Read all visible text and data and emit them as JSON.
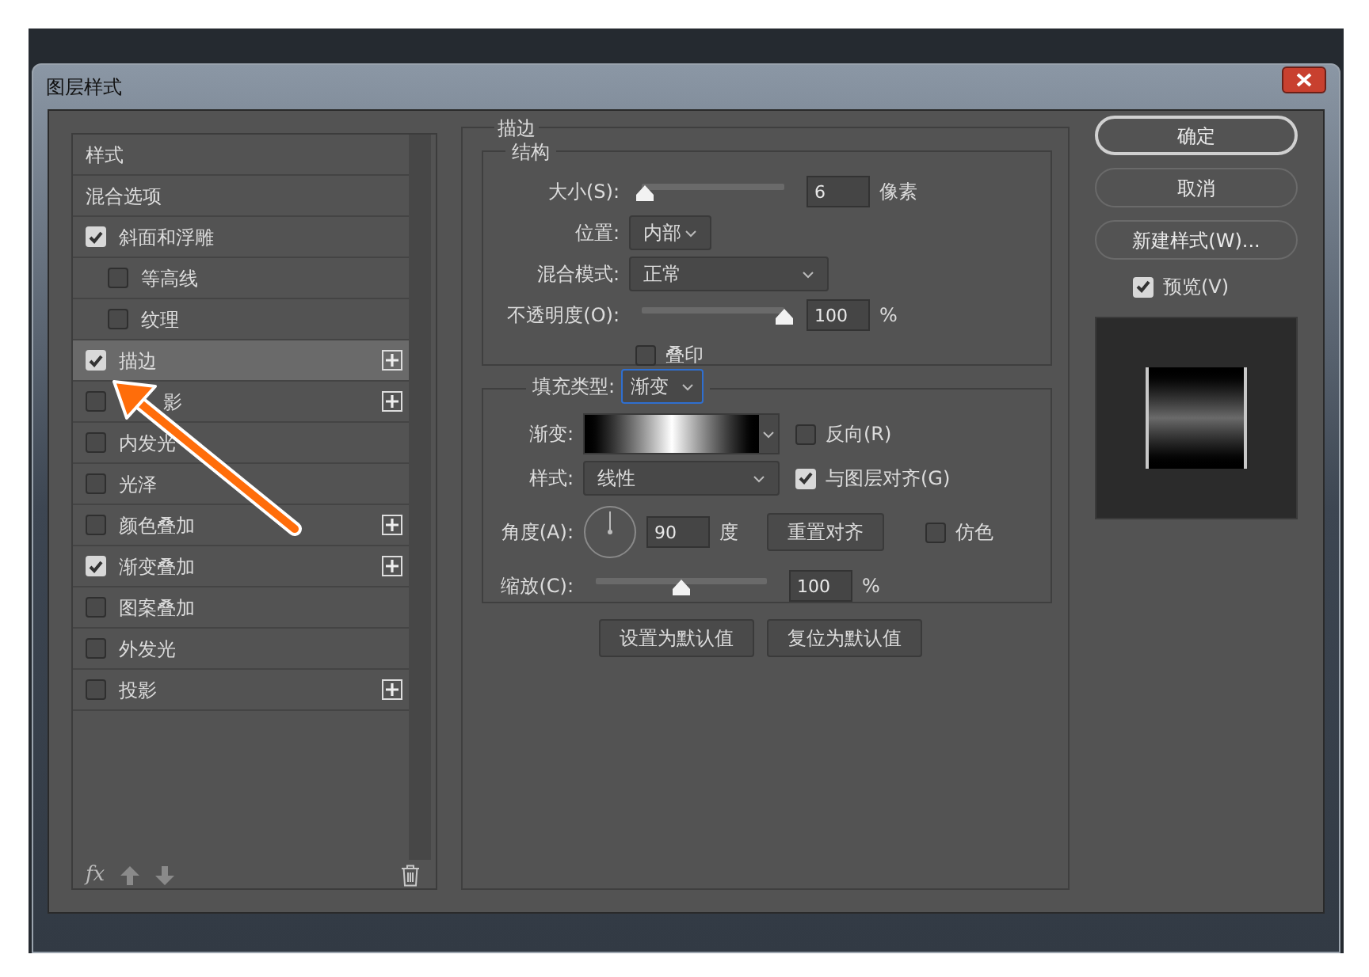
{
  "window": {
    "title": "图层样式"
  },
  "styles_list": {
    "items": [
      {
        "label": "样式",
        "kind": "heading",
        "selected": false
      },
      {
        "label": "混合选项",
        "kind": "heading",
        "selected": false
      },
      {
        "label": "斜面和浮雕",
        "kind": "effect",
        "checked": true,
        "selected": false,
        "add_button": false,
        "children": [
          {
            "label": "等高线",
            "kind": "effect",
            "checked": false,
            "selected": false,
            "add_button": false
          },
          {
            "label": "纹理",
            "kind": "effect",
            "checked": false,
            "selected": false,
            "add_button": false
          }
        ]
      },
      {
        "label": "描边",
        "kind": "effect",
        "checked": true,
        "selected": true,
        "add_button": true
      },
      {
        "label": "影",
        "kind": "effect",
        "checked": false,
        "selected": false,
        "add_button": true,
        "covered": true
      },
      {
        "label": "内发光",
        "kind": "effect",
        "checked": false,
        "selected": false,
        "add_button": false
      },
      {
        "label": "光泽",
        "kind": "effect",
        "checked": false,
        "selected": false,
        "add_button": false
      },
      {
        "label": "颜色叠加",
        "kind": "effect",
        "checked": false,
        "selected": false,
        "add_button": true
      },
      {
        "label": "渐变叠加",
        "kind": "effect",
        "checked": true,
        "selected": false,
        "add_button": true
      },
      {
        "label": "图案叠加",
        "kind": "effect",
        "checked": false,
        "selected": false,
        "add_button": false
      },
      {
        "label": "外发光",
        "kind": "effect",
        "checked": false,
        "selected": false,
        "add_button": false
      },
      {
        "label": "投影",
        "kind": "effect",
        "checked": false,
        "selected": false,
        "add_button": true
      }
    ],
    "fx_label": "fx"
  },
  "stroke": {
    "title": "描边",
    "structure": {
      "title": "结构",
      "size": {
        "label": "大小(S):",
        "level": 0.02,
        "value": "6",
        "unit": "像素"
      },
      "position": {
        "label": "位置:",
        "value": "内部"
      },
      "blend_mode": {
        "label": "混合模式:",
        "value": "正常"
      },
      "opacity": {
        "label": "不透明度(O):",
        "level": 1.0,
        "value": "100",
        "unit": "%"
      },
      "overprint": {
        "label": "叠印",
        "checked": false
      }
    },
    "fill": {
      "label": "填充类型:",
      "value": "渐变",
      "gradient": {
        "label": "渐变:"
      },
      "reverse": {
        "label": "反向(R)",
        "checked": false
      },
      "style": {
        "label": "样式:",
        "value": "线性"
      },
      "align_with_layer": {
        "label": "与图层对齐(G)",
        "checked": true
      },
      "angle": {
        "label": "角度(A):",
        "value": "90",
        "unit": "度"
      },
      "reset_alignment": "重置对齐",
      "dither": {
        "label": "仿色",
        "checked": false
      },
      "scale": {
        "label": "缩放(C):",
        "level": 0.5,
        "value": "100",
        "unit": "%"
      }
    },
    "buttons": [
      "设置为默认值",
      "复位为默认值"
    ]
  },
  "actions": [
    "确定",
    "取消",
    "新建样式(W)..."
  ],
  "preview": {
    "label": "预览(V)",
    "checked": true
  }
}
